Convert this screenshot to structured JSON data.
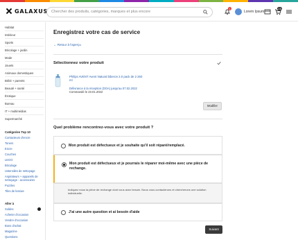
{
  "brand": {
    "name": "GALAXUS",
    "rainbow": [
      "#e53935",
      "#fb8c00",
      "#fdd835",
      "#43a047",
      "#1e88e5",
      "#8e24aa",
      "#00acc1",
      "#ec407a",
      "#7cb342",
      "#ffb300",
      "#5e35b1",
      "#26a69a"
    ]
  },
  "header": {
    "search_placeholder": "Chercher des produits, catégories, marques et plus encore",
    "username": "Lorem Ipsum",
    "notification_badge": "1",
    "cart_badge": "10"
  },
  "sidebar": {
    "categories": [
      "Habitat",
      "Intérieur",
      "Sports",
      "Bricolage + jardin",
      "Mode",
      "Jouets",
      "Animaux domestiques",
      "Bébé + parents",
      "Beauté + santé",
      "Érotique",
      "Bureau",
      "IT + multimédias",
      "Supermarché"
    ],
    "top_heading": "Catégories Top 10",
    "top_links": [
      "Contacteurs d'encre",
      "Toners",
      "Encre",
      "Couches",
      "LEGO",
      "Bricolage",
      "Ustensiles de nettoyage",
      "Aspirateurs + appareils de nettoyage - accessoires",
      "Puzzles",
      "Tiles de lessive"
    ],
    "aller_heading": "Aller à",
    "aller_links": [
      "Soldes",
      "Acheter d'occasion",
      "Vendre d'occasion",
      "Bons d'achat",
      "Magazine",
      "Questions"
    ]
  },
  "main": {
    "title": "Enregistrez votre cas de service",
    "back_link": "Retour à l'aperçu",
    "section1_title": "Sélectionnez votre produit",
    "product": {
      "name": "Philips AVENT Avent Natural biberon 2.0 pack de 2 260 ml",
      "delivered": "Délivrance à la réception (DOA) jusqu'au 07.02.2022",
      "ordered": "Commandé le 23.01.2022"
    },
    "modify_button": "Modifier",
    "section2_title": "Quel problème rencontrez-vous avec votre produit ?",
    "options": [
      {
        "label": "Mon produit est défectueux et je souhaite qu'il soit réparé/remplacé.",
        "selected": false
      },
      {
        "label": "Mon produit est défectueux et je pourrais le réparer moi-même avec une pièce de rechange.",
        "selected": true
      },
      {
        "label": "J'ai une autre question et ai besoin d'aide",
        "selected": false
      }
    ],
    "info_text": "Indiquez nous la pièce de rechange dont vous avez besoin. Nous vous contacterons et chercherons une solution individuelle.",
    "next_button": "Suivant"
  },
  "colors": {
    "accent": "#2b64b0",
    "selected_border": "#f2b01e",
    "primary_button": "#3a3a3a"
  }
}
